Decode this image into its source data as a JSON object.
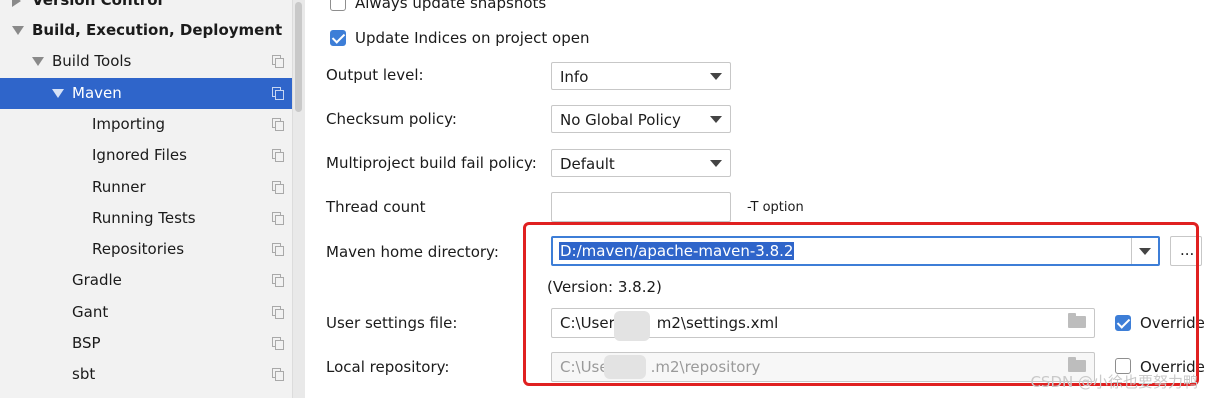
{
  "sidebar": {
    "items": [
      {
        "label": "Version Control",
        "level": 0,
        "expanded": false,
        "bold": true,
        "selected": false
      },
      {
        "label": "Build, Execution, Deployment",
        "level": 0,
        "expanded": true,
        "bold": true,
        "selected": false
      },
      {
        "label": "Build Tools",
        "level": 1,
        "expanded": true,
        "bold": false,
        "selected": false
      },
      {
        "label": "Maven",
        "level": 2,
        "expanded": true,
        "bold": false,
        "selected": true
      },
      {
        "label": "Importing",
        "level": 3,
        "bold": false,
        "selected": false
      },
      {
        "label": "Ignored Files",
        "level": 3,
        "bold": false,
        "selected": false
      },
      {
        "label": "Runner",
        "level": 3,
        "bold": false,
        "selected": false
      },
      {
        "label": "Running Tests",
        "level": 3,
        "bold": false,
        "selected": false
      },
      {
        "label": "Repositories",
        "level": 3,
        "bold": false,
        "selected": false
      },
      {
        "label": "Gradle",
        "level": 2,
        "bold": false,
        "selected": false
      },
      {
        "label": "Gant",
        "level": 2,
        "bold": false,
        "selected": false
      },
      {
        "label": "BSP",
        "level": 2,
        "bold": false,
        "selected": false
      },
      {
        "label": "sbt",
        "level": 2,
        "bold": false,
        "selected": false
      }
    ]
  },
  "settings": {
    "always_update_snapshots": {
      "label": "Always update snapshots",
      "checked": false
    },
    "update_indices": {
      "label": "Update Indices on project open",
      "checked": true
    },
    "output_level": {
      "label": "Output level:",
      "value": "Info"
    },
    "checksum_policy": {
      "label": "Checksum policy:",
      "value": "No Global Policy"
    },
    "multiproject_fail_policy": {
      "label": "Multiproject build fail policy:",
      "value": "Default"
    },
    "thread_count": {
      "label": "Thread count",
      "value": "",
      "hint": "-T option"
    },
    "maven_home": {
      "label": "Maven home directory:",
      "value": "D:/maven/apache-maven-3.8.2",
      "browse_label": "...",
      "version": "(Version: 3.8.2)"
    },
    "user_settings": {
      "label": "User settings file:",
      "value_prefix": "C:\\User",
      "value_suffix": "m2\\settings.xml",
      "override_label": "Override",
      "override_checked": true
    },
    "local_repo": {
      "label": "Local repository:",
      "value_prefix": "C:\\Use",
      "value_suffix": ".m2\\repository",
      "override_label": "Override",
      "override_checked": false
    }
  },
  "watermark": "CSDN @小徐也要努力鸭",
  "colors": {
    "selection": "#2f65ca",
    "highlight_box": "#e02020",
    "checkbox_checked": "#3d7ed7"
  }
}
